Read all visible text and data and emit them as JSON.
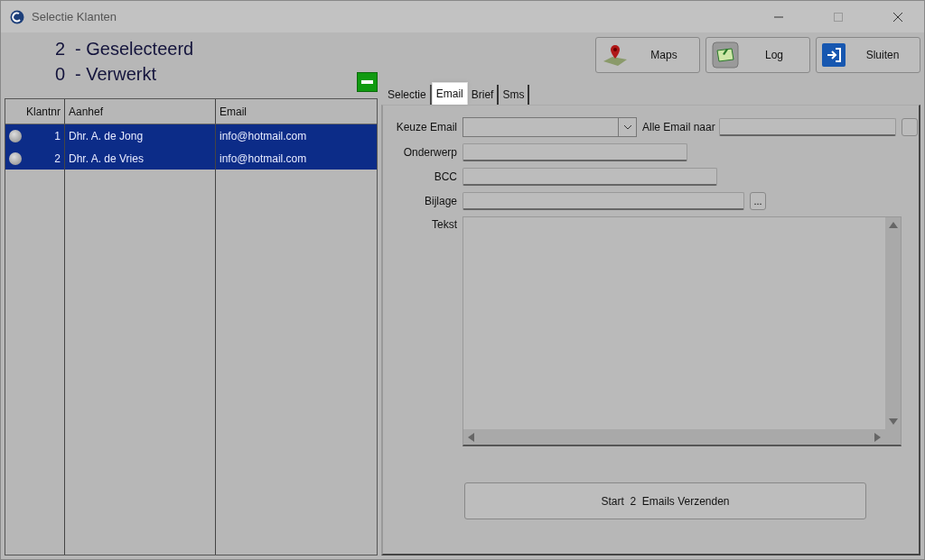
{
  "window": {
    "title": "Selectie Klanten"
  },
  "counters": [
    {
      "count": "2",
      "label": "- Geselecteerd"
    },
    {
      "count": "0",
      "label": "- Verwerkt"
    }
  ],
  "toolbar_buttons": [
    {
      "label": "Maps",
      "kind": "maps"
    },
    {
      "label": "Log",
      "kind": "log"
    },
    {
      "label": "Sluiten",
      "kind": "exit"
    }
  ],
  "table": {
    "columns": [
      "Klantnr",
      "Aanhef",
      "Email"
    ],
    "rows": [
      {
        "klantnr": "1",
        "aanhef": "Dhr. A. de Jong",
        "email": "info@hotmail.com",
        "selected": true
      },
      {
        "klantnr": "2",
        "aanhef": "Dhr. A. de Vries",
        "email": "info@hotmail.com",
        "selected": true
      }
    ]
  },
  "tabs": [
    {
      "label": "Selectie",
      "selected": false
    },
    {
      "label": "Email",
      "selected": true
    },
    {
      "label": "Brief",
      "selected": false
    },
    {
      "label": "Sms",
      "selected": false
    }
  ],
  "email_form": {
    "keuze_email_label": "Keuze Email",
    "alle_email_naar_label": "Alle Email naar",
    "onderwerp_label": "Onderwerp",
    "bcc_label": "BCC",
    "bijlage_label": "Bijlage",
    "browse_button": "...",
    "tekst_label": "Tekst",
    "send_button": "Start  2  Emails Verzenden"
  }
}
